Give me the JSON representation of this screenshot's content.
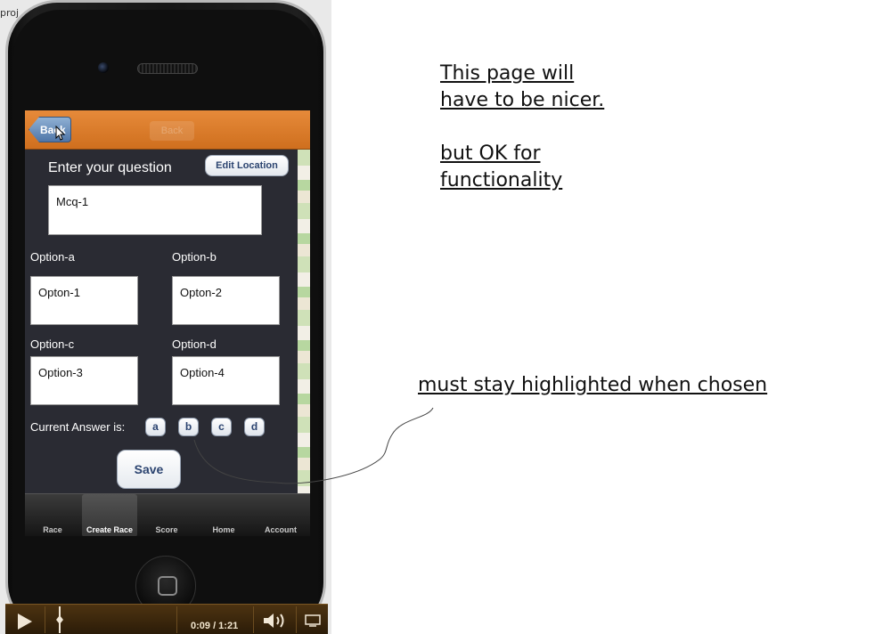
{
  "browser": {
    "snippet": "proj"
  },
  "app": {
    "navbar": {
      "back_label": "Back",
      "ghost_label": "Back"
    },
    "form": {
      "question_label": "Enter your question",
      "edit_location_label": "Edit Location",
      "question_value": "Mcq-1",
      "options": [
        {
          "label": "Option-a",
          "value": "Opton-1"
        },
        {
          "label": "Option-b",
          "value": "Opton-2"
        },
        {
          "label": "Option-c",
          "value": "Option-3"
        },
        {
          "label": "Option-d",
          "value": "Option-4"
        }
      ],
      "answer_label": "Current Answer is:",
      "answer_choices": [
        "a",
        "b",
        "c",
        "d"
      ],
      "save_label": "Save"
    },
    "tabs": [
      {
        "label": "Race"
      },
      {
        "label": "Create Race",
        "active": true
      },
      {
        "label": "Score"
      },
      {
        "label": "Home"
      },
      {
        "label": "Account"
      }
    ]
  },
  "video": {
    "time": "0:09 / 1:21"
  },
  "annotations": {
    "note1_line1": "This page will",
    "note1_line2": "have to be nicer. ",
    "note2_line1": "but OK for",
    "note2_line2": "functionality",
    "note3": "must stay highlighted when chosen"
  },
  "colors": {
    "navbar": "#e07f2c",
    "form_bg": "#2a2b33",
    "button_text": "#2c4470",
    "video_bar": "#3a260c"
  }
}
